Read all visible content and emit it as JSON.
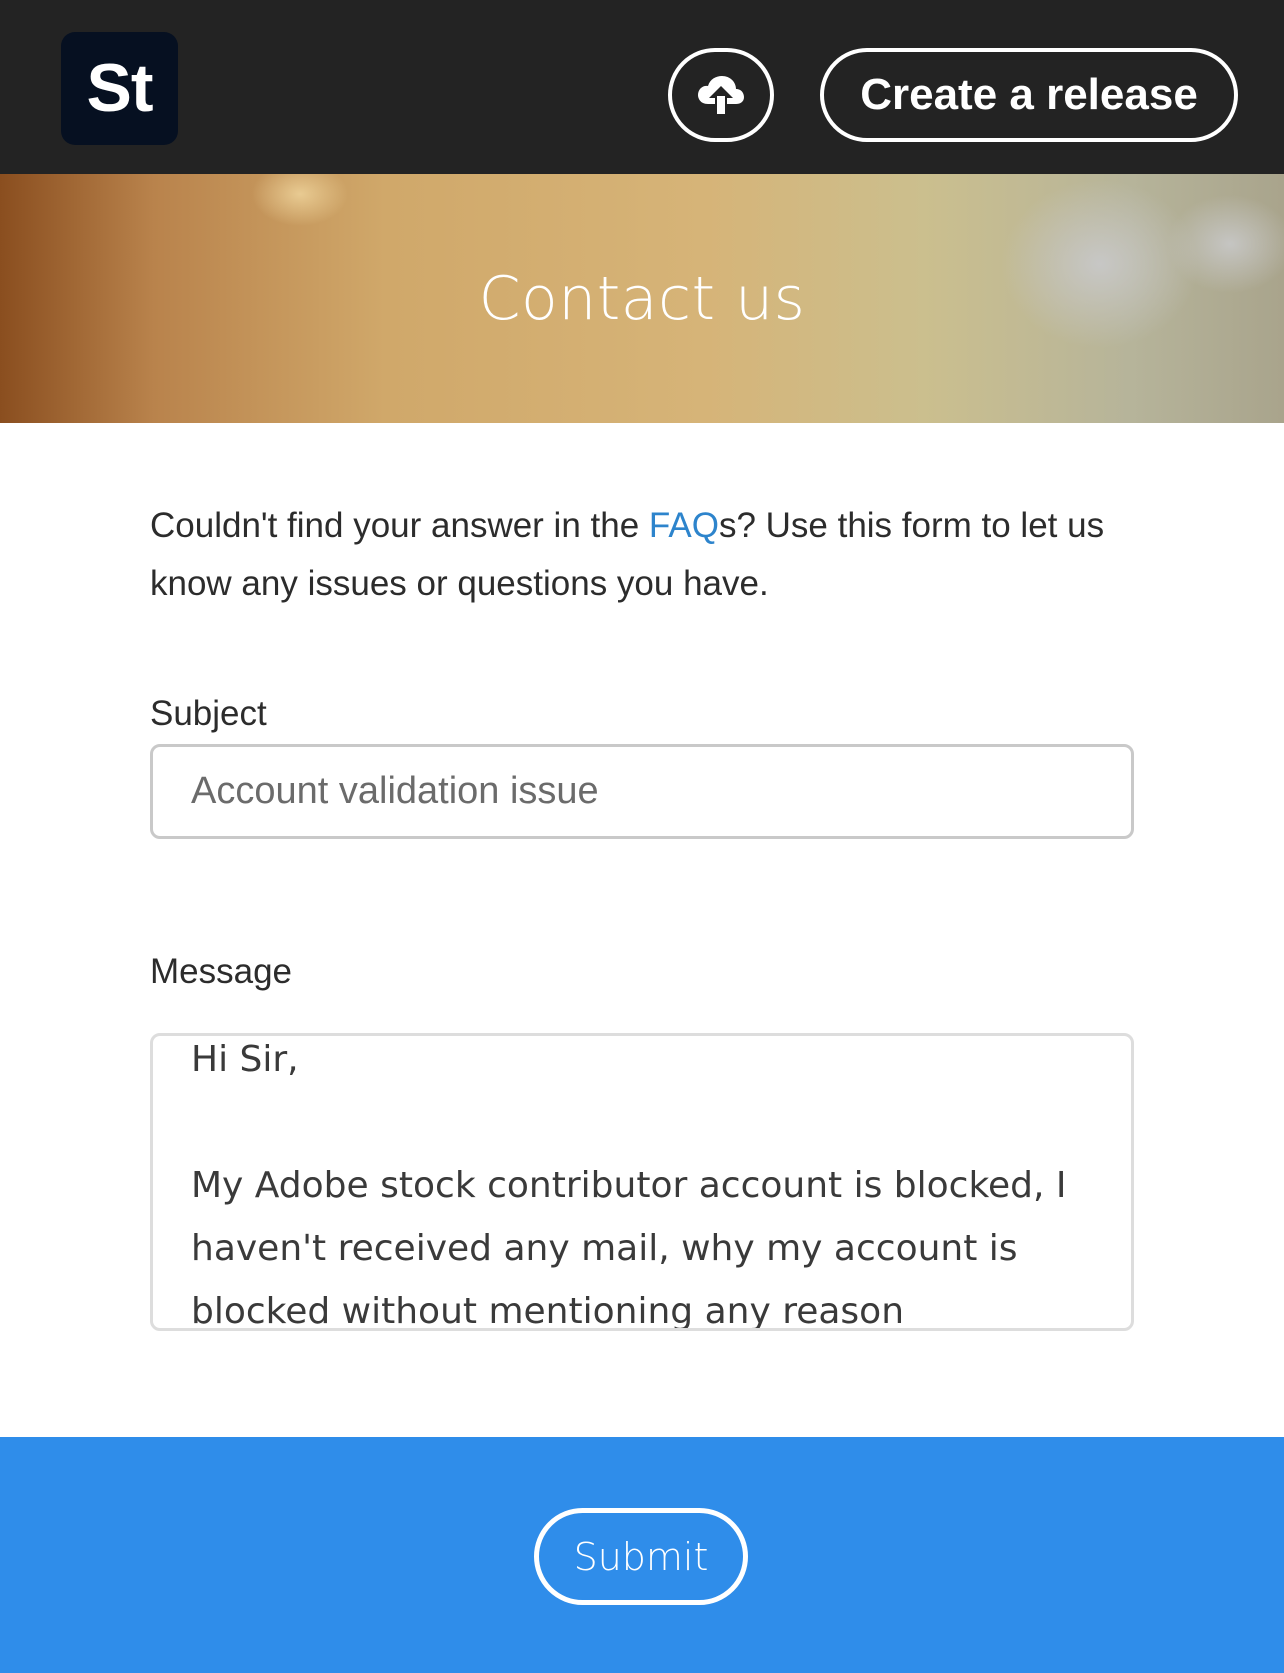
{
  "header": {
    "logo_text": "St",
    "upload_icon": "cloud-upload-icon",
    "create_release_label": "Create a release"
  },
  "hero": {
    "title": "Contact us"
  },
  "intro": {
    "text_before_link": "Couldn't find your answer in the ",
    "link_text": "FAQ",
    "text_after_link": "s? Use this form to let us know any issues or questions you have."
  },
  "form": {
    "subject_label": "Subject",
    "subject_value": "Account validation issue",
    "message_label": "Message",
    "message_value": "Hi Sir,\n\nMy Adobe stock contributor account is blocked, I haven't received any mail, why my account is blocked without mentioning any reason"
  },
  "footer": {
    "submit_label": "Submit"
  },
  "colors": {
    "header_bg": "#232323",
    "logo_bg": "#061021",
    "link": "#2d84cc",
    "footer_bg": "#2f8dea"
  }
}
